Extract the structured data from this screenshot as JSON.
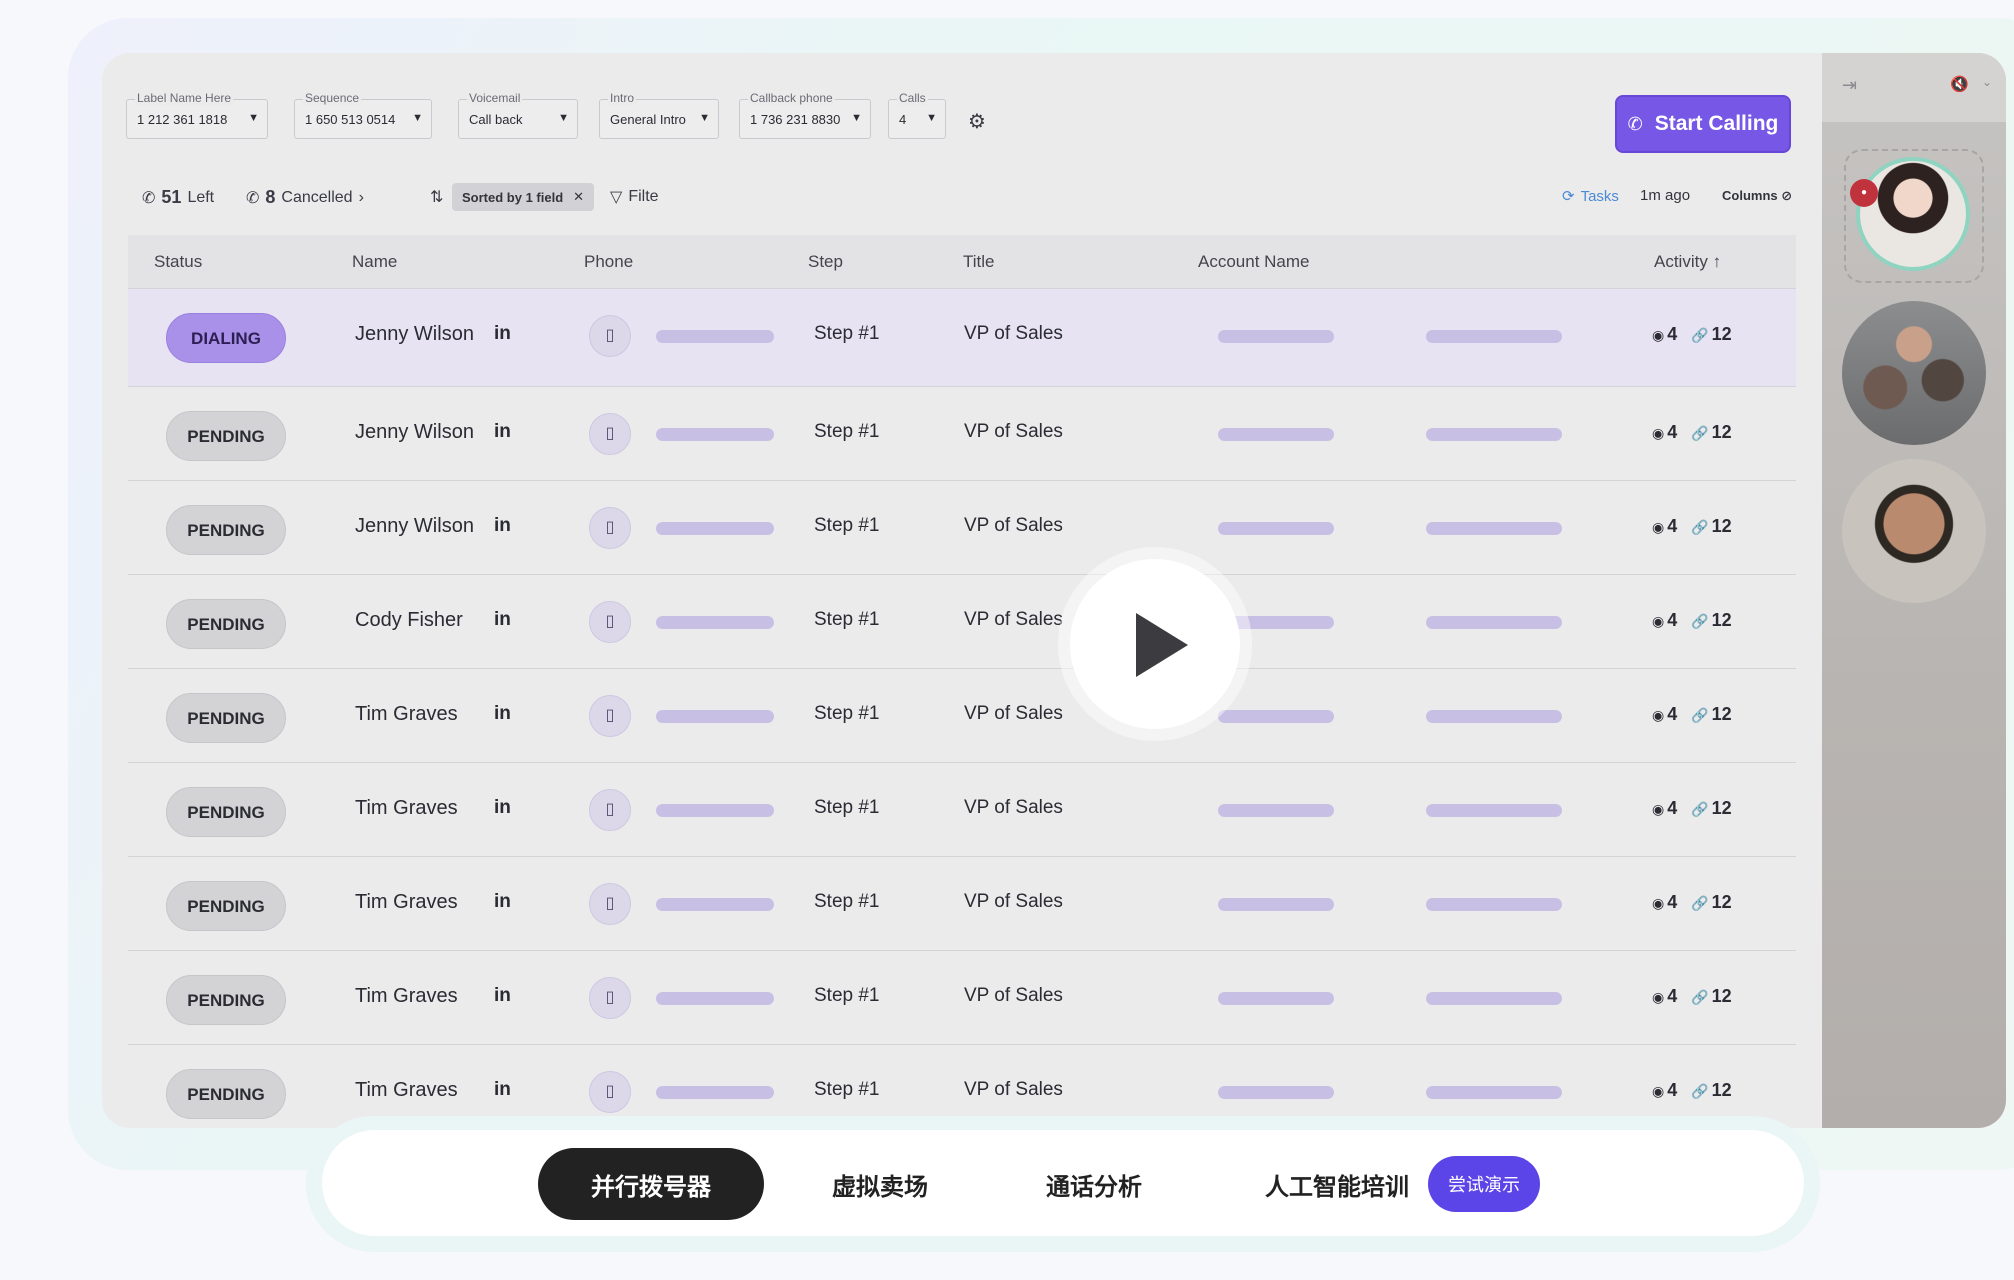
{
  "toolbar": {
    "fields": [
      {
        "label": "Label Name Here",
        "value": "1 212 361 1818"
      },
      {
        "label": "Sequence",
        "value": "1 650 513 0514"
      },
      {
        "label": "Voicemail",
        "value": "Call back"
      },
      {
        "label": "Intro",
        "value": "General Intro"
      },
      {
        "label": "Callback phone",
        "value": "1 736 231 8830"
      },
      {
        "label": "Calls",
        "value": "4"
      }
    ],
    "start_label": "Start Calling"
  },
  "subbar": {
    "left_count": "51",
    "left_label": "Left",
    "cancelled_count": "8",
    "cancelled_label": "Cancelled",
    "sorted_label": "Sorted by 1 field",
    "filter_label": "Filte",
    "tasks_label": "Tasks",
    "ago_label": "1m ago",
    "columns_label": "Columns"
  },
  "table": {
    "headers": [
      "Status",
      "Name",
      "Phone",
      "Step",
      "Title",
      "Account Name",
      "Activity"
    ],
    "rows": [
      {
        "status": "DIALING",
        "name": "Jenny Wilson",
        "step": "Step #1",
        "title": "VP of Sales",
        "views": "4",
        "links": "12"
      },
      {
        "status": "PENDING",
        "name": "Jenny Wilson",
        "step": "Step #1",
        "title": "VP of Sales",
        "views": "4",
        "links": "12"
      },
      {
        "status": "PENDING",
        "name": "Jenny Wilson",
        "step": "Step #1",
        "title": "VP of Sales",
        "views": "4",
        "links": "12"
      },
      {
        "status": "PENDING",
        "name": "Cody Fisher",
        "step": "Step #1",
        "title": "VP of Sales",
        "views": "4",
        "links": "12"
      },
      {
        "status": "PENDING",
        "name": "Tim Graves",
        "step": "Step #1",
        "title": "VP of Sales",
        "views": "4",
        "links": "12"
      },
      {
        "status": "PENDING",
        "name": "Tim Graves",
        "step": "Step #1",
        "title": "VP of Sales",
        "views": "4",
        "links": "12"
      },
      {
        "status": "PENDING",
        "name": "Tim Graves",
        "step": "Step #1",
        "title": "VP of Sales",
        "views": "4",
        "links": "12"
      },
      {
        "status": "PENDING",
        "name": "Tim Graves",
        "step": "Step #1",
        "title": "VP of Sales",
        "views": "4",
        "links": "12"
      },
      {
        "status": "PENDING",
        "name": "Tim Graves",
        "step": "Step #1",
        "title": "VP of Sales",
        "views": "4",
        "links": "12"
      }
    ],
    "linkedin_label": "in"
  },
  "bottom_nav": {
    "tabs": [
      "并行拨号器",
      "虚拟卖场",
      "通话分析",
      "人工智能培训"
    ],
    "try_label": "尝试演示"
  },
  "colors": {
    "accent": "#7657e6",
    "dialing": "#a990e8",
    "try_badge": "#5b44e8"
  },
  "icons": [
    "phone-icon",
    "sort-icon",
    "filter-icon",
    "refresh-icon",
    "columns-hidden-icon",
    "eye-icon",
    "link-icon",
    "play-icon",
    "collapse-icon",
    "mute-icon"
  ]
}
